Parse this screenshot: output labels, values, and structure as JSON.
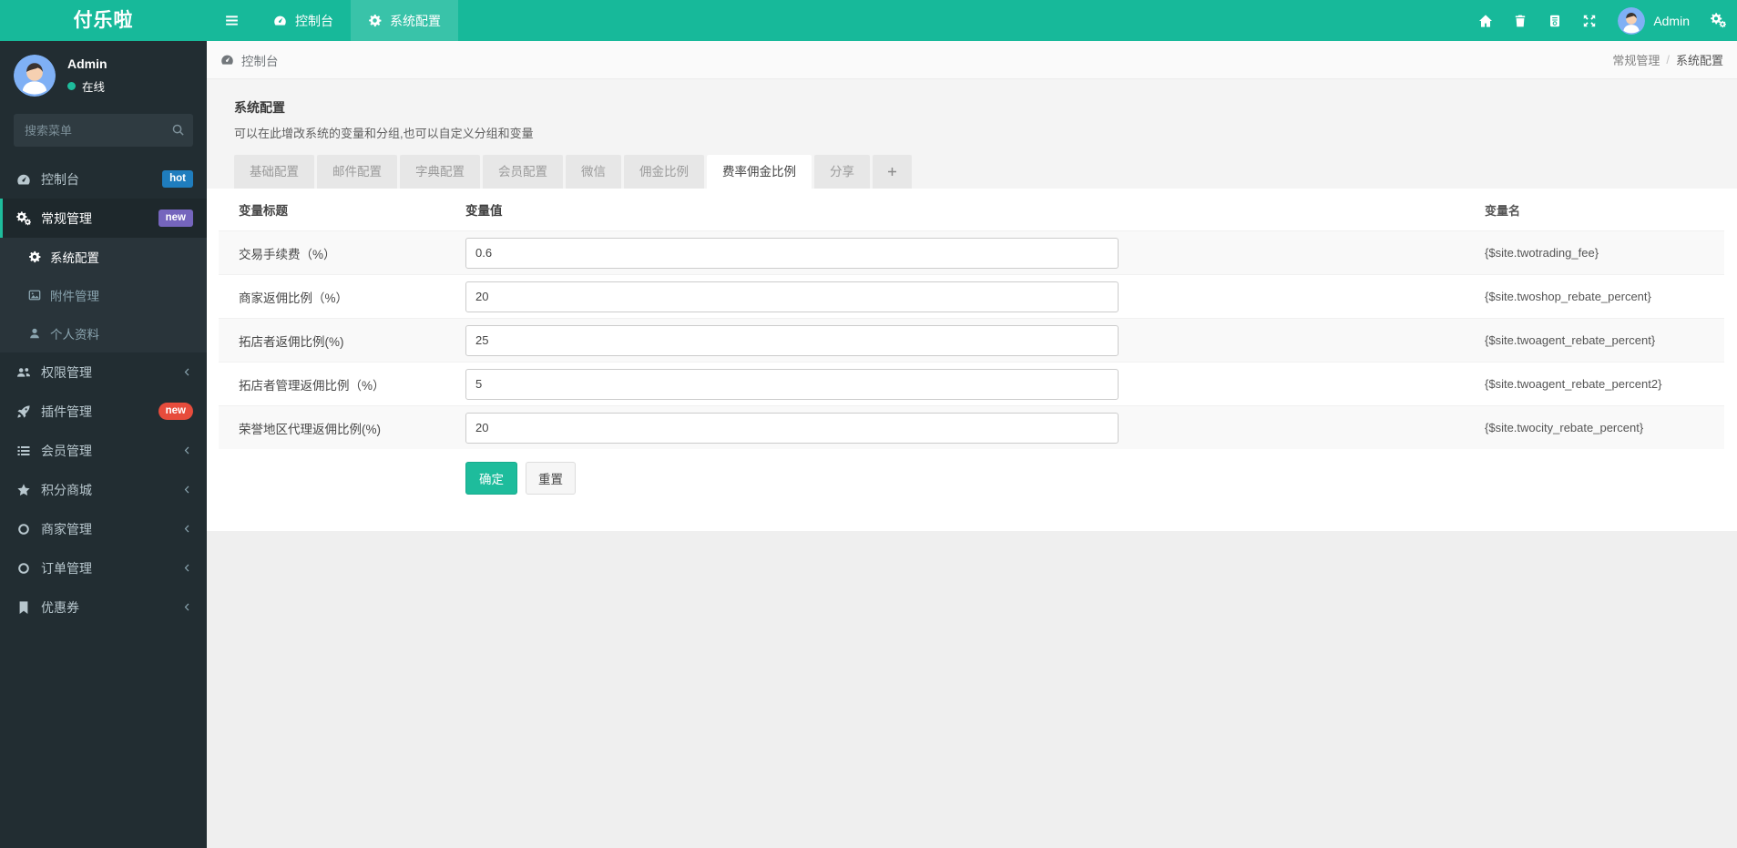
{
  "app": {
    "logo": "付乐啦"
  },
  "colors": {
    "accent_teal": "#17b99a",
    "button_teal": "#1ebc9c",
    "sidebar_dark": "#222d32",
    "status_online_green": "#1ebc9c",
    "badge_hot_blue": "#1f7dbe",
    "badge_new_purple": "#7565bd",
    "badge_new_red": "#e74c3c"
  },
  "topbar": {
    "hamburger_icon": "bars",
    "nav": [
      {
        "label": "控制台",
        "icon": "gauge",
        "active": false
      },
      {
        "label": "系统配置",
        "icon": "gear",
        "active": true
      }
    ],
    "right_icons": [
      {
        "name": "home",
        "icon": "home"
      },
      {
        "name": "trash",
        "icon": "trash"
      },
      {
        "name": "log",
        "icon": "log"
      },
      {
        "name": "fullscreen",
        "icon": "expand"
      }
    ],
    "user": {
      "name": "Admin",
      "avatar_icon": "avatar"
    },
    "settings_icon": "cogs"
  },
  "sidebar": {
    "user": {
      "name": "Admin",
      "status": "在线",
      "avatar_icon": "avatar"
    },
    "search": {
      "placeholder": "搜索菜单",
      "icon": "search"
    },
    "menu": [
      {
        "label": "控制台",
        "icon": "gauge",
        "badge": {
          "text": "hot",
          "color": "#1f7dbe",
          "pill": false
        }
      },
      {
        "label": "常规管理",
        "icon": "cogs",
        "active": true,
        "badge": {
          "text": "new",
          "color": "#7565bd",
          "pill": false
        },
        "children": [
          {
            "label": "系统配置",
            "icon": "gear",
            "active": true
          },
          {
            "label": "附件管理",
            "icon": "image"
          },
          {
            "label": "个人资料",
            "icon": "user"
          }
        ]
      },
      {
        "label": "权限管理",
        "icon": "users",
        "chevron": true
      },
      {
        "label": "插件管理",
        "icon": "rocket",
        "badge": {
          "text": "new",
          "color": "#e74c3c",
          "pill": true
        }
      },
      {
        "label": "会员管理",
        "icon": "list",
        "chevron": true
      },
      {
        "label": "积分商城",
        "icon": "star",
        "chevron": true
      },
      {
        "label": "商家管理",
        "icon": "circle",
        "chevron": true
      },
      {
        "label": "订单管理",
        "icon": "circle",
        "chevron": true
      },
      {
        "label": "优惠券",
        "icon": "bookmark",
        "chevron": true
      }
    ]
  },
  "breadcrumb": {
    "left": {
      "label": "控制台",
      "icon": "gauge"
    },
    "right": {
      "parent": "常规管理",
      "separator": "/",
      "current": "系统配置"
    }
  },
  "panel": {
    "title": "系统配置",
    "subtitle": "可以在此增改系统的变量和分组,也可以自定义分组和变量",
    "tabs": [
      "基础配置",
      "邮件配置",
      "字典配置",
      "会员配置",
      "微信",
      "佣金比例",
      "费率佣金比例",
      "分享"
    ],
    "active_tab": "费率佣金比例",
    "add_tab_icon": "plus",
    "table": {
      "headers": [
        "变量标题",
        "变量值",
        "变量名"
      ],
      "rows": [
        {
          "title": "交易手续费（%）",
          "value": "0.6",
          "var": "{$site.twotrading_fee}"
        },
        {
          "title": "商家返佣比例（%）",
          "value": "20",
          "var": "{$site.twoshop_rebate_percent}"
        },
        {
          "title": "拓店者返佣比例(%)",
          "value": "25",
          "var": "{$site.twoagent_rebate_percent}"
        },
        {
          "title": "拓店者管理返佣比例（%）",
          "value": "5",
          "var": "{$site.twoagent_rebate_percent2}"
        },
        {
          "title": "荣誉地区代理返佣比例(%)",
          "value": "20",
          "var": "{$site.twocity_rebate_percent}"
        }
      ],
      "buttons": {
        "ok": "确定",
        "reset": "重置"
      }
    }
  }
}
